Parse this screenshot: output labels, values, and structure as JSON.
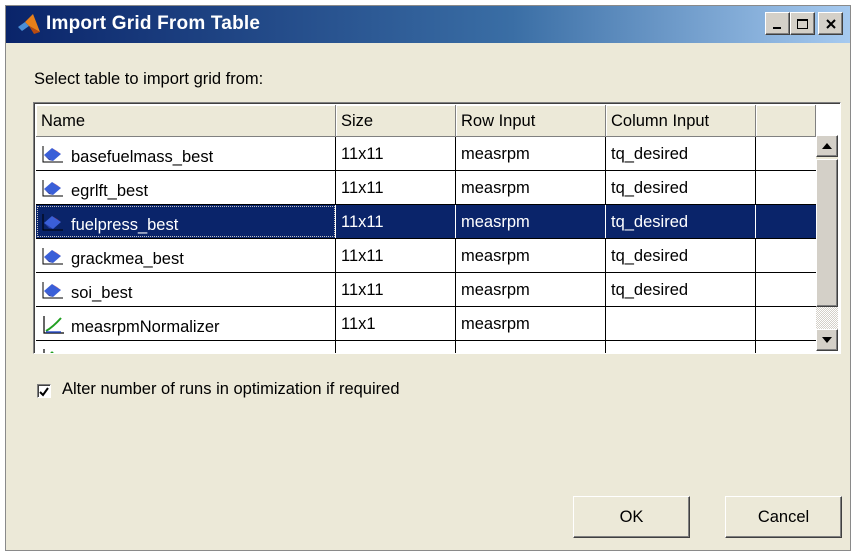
{
  "window": {
    "title": "Import Grid From Table"
  },
  "prompt": "Select table to import grid from:",
  "table": {
    "columns": [
      "Name",
      "Size",
      "Row Input",
      "Column Input"
    ],
    "rows": [
      {
        "icon": "surface-icon",
        "name": "basefuelmass_best",
        "size": "11x11",
        "row_input": "measrpm",
        "column_input": "tq_desired",
        "selected": false
      },
      {
        "icon": "surface-icon",
        "name": "egrlft_best",
        "size": "11x11",
        "row_input": "measrpm",
        "column_input": "tq_desired",
        "selected": false
      },
      {
        "icon": "surface-icon",
        "name": "fuelpress_best",
        "size": "11x11",
        "row_input": "measrpm",
        "column_input": "tq_desired",
        "selected": true
      },
      {
        "icon": "surface-icon",
        "name": "grackmea_best",
        "size": "11x11",
        "row_input": "measrpm",
        "column_input": "tq_desired",
        "selected": false
      },
      {
        "icon": "surface-icon",
        "name": "soi_best",
        "size": "11x11",
        "row_input": "measrpm",
        "column_input": "tq_desired",
        "selected": false
      },
      {
        "icon": "normalizer-icon",
        "name": "measrpmNormalizer",
        "size": "11x1",
        "row_input": "measrpm",
        "column_input": "",
        "selected": false
      }
    ]
  },
  "options": {
    "alter_runs_label": "Alter number of runs in optimization if required",
    "alter_runs_checked": true
  },
  "buttons": {
    "ok": "OK",
    "cancel": "Cancel"
  },
  "colors": {
    "title_start": "#0a246a",
    "title_end": "#a6caf0",
    "selection": "#0a246a",
    "face": "#ece9d8"
  }
}
